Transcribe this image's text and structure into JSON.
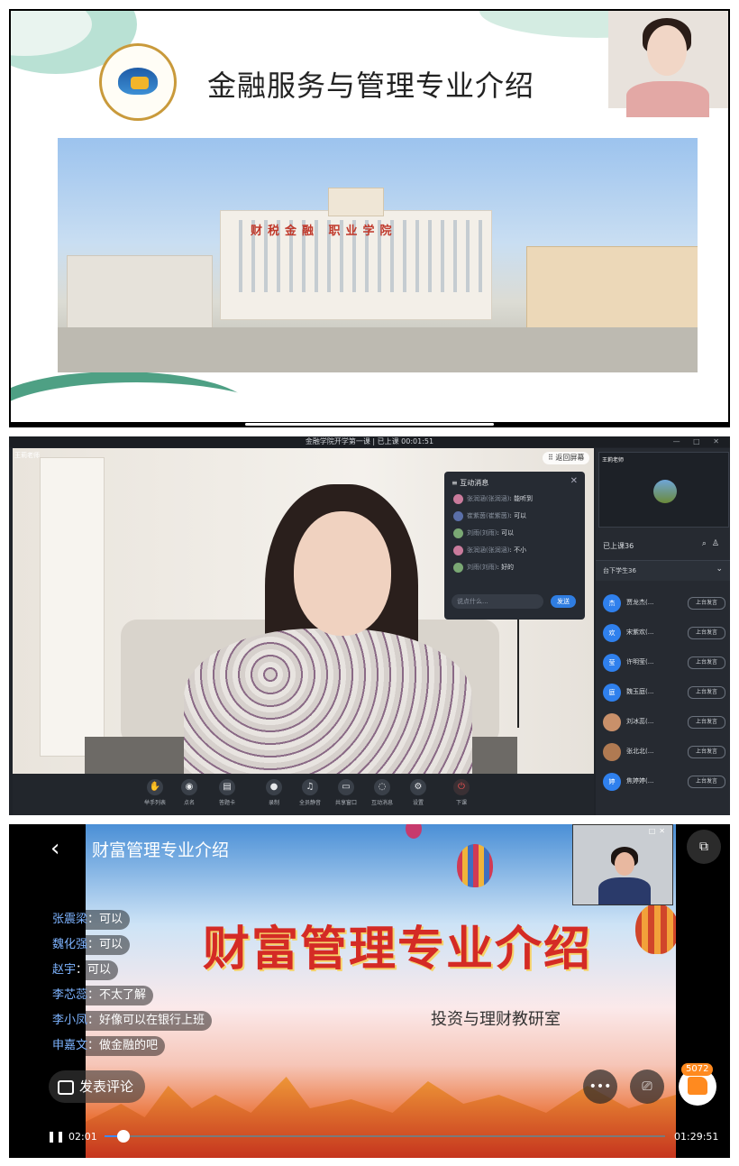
{
  "panel1": {
    "slide_title": "金融服务与管理专业介绍",
    "banner_text": "财税金融 职业学院"
  },
  "panel2": {
    "window_title": "金融学院开学第一课 | 已上课 00:01:51",
    "teacher_label": "王莉老师",
    "return_button": "返回屏幕",
    "chat": {
      "title": "互动消息",
      "messages": [
        {
          "name": "张润涵(张润涵)",
          "text": "能听到"
        },
        {
          "name": "崔紫茵(崔紫茵)",
          "text": "可以"
        },
        {
          "name": "刘雨(刘雨)",
          "text": "可以"
        },
        {
          "name": "张润涵(张润涵)",
          "text": "不小"
        },
        {
          "name": "刘雨(刘雨)",
          "text": "好的"
        }
      ],
      "input_placeholder": "说点什么...",
      "send": "发送"
    },
    "toolbar": [
      "举手列表",
      "点名",
      "答题卡",
      "录制",
      "全员静音",
      "共享窗口",
      "互动消息",
      "设置",
      "下课"
    ],
    "sidebar": {
      "cam_label": "王莉老师",
      "attended": "已上课36",
      "offstage": "台下学生36",
      "stage_button": "上台发言",
      "students": [
        {
          "avatar": "杰",
          "name": "贾龙杰(..."
        },
        {
          "avatar": "欢",
          "name": "宋紫欢(..."
        },
        {
          "avatar": "莹",
          "name": "许明莹(..."
        },
        {
          "avatar": "庭",
          "name": "魏玉庭(..."
        },
        {
          "avatar": "",
          "name": "刘冰蕊(..."
        },
        {
          "avatar": "",
          "name": "张北北(..."
        },
        {
          "avatar": "婷",
          "name": "焦婷婷(..."
        }
      ]
    }
  },
  "panel3": {
    "video_title": "财富管理专业介绍",
    "slide_title": "财富管理专业介绍",
    "slide_subtitle": "投资与理财教研室",
    "comments": [
      {
        "name": "张震梁",
        "text": "：可以"
      },
      {
        "name": "魏化强",
        "text": "：可以"
      },
      {
        "name": "赵宇",
        "text": "：可以"
      },
      {
        "name": "李芯蕊",
        "text": "：不太了解"
      },
      {
        "name": "李小凤",
        "text": "：好像可以在银行上班"
      },
      {
        "name": "申嘉文",
        "text": "：做金融的吧"
      }
    ],
    "comment_button": "发表评论",
    "like_count": "5072",
    "current_time": "02:01",
    "total_time": "01:29:51",
    "progress": 0.033
  }
}
